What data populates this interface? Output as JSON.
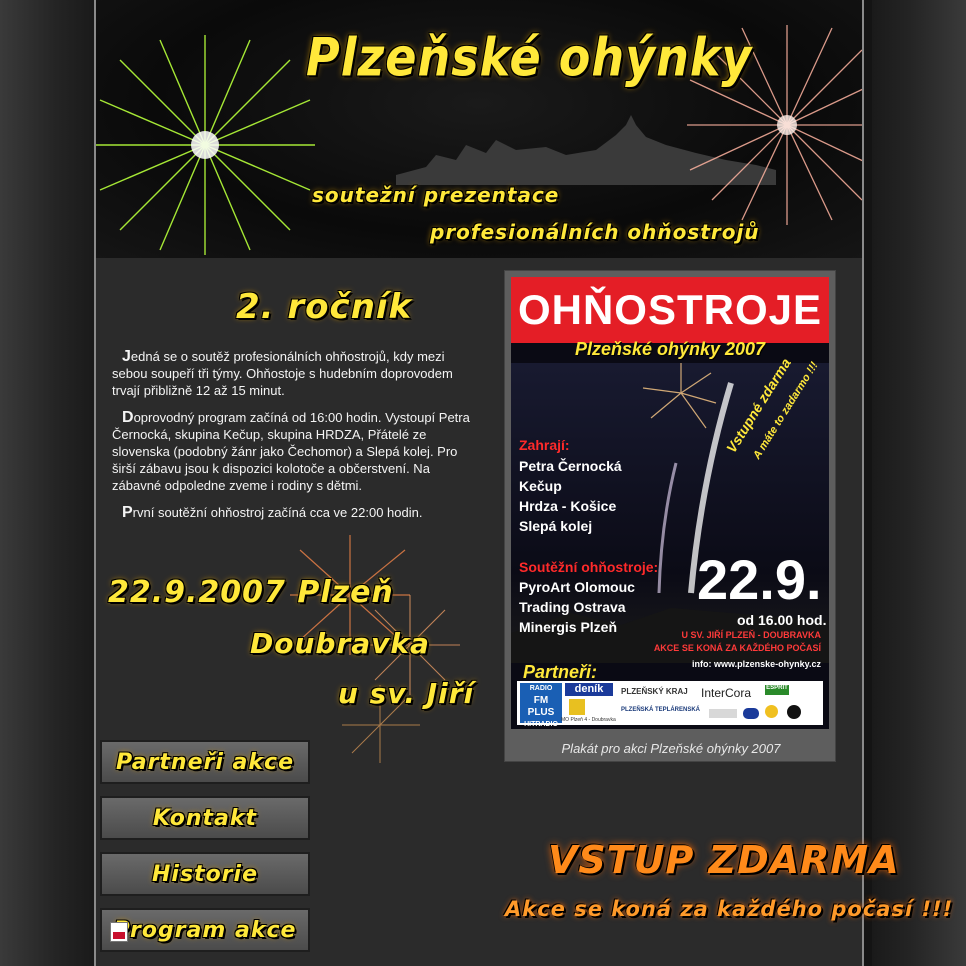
{
  "header": {
    "title": "Plzeňské ohýnky",
    "tagline1": "soutežní prezentace",
    "tagline2": "profesionálních ohňostrojů"
  },
  "main": {
    "edition": "2. ročník",
    "paragraphs": [
      {
        "cap": "J",
        "text": "edná se o soutěž profesionálních ohňostrojů, kdy mezi sebou soupeří tři týmy. Ohňostoje s hudebním doprovodem trvají přibližně 12 až 15 minut."
      },
      {
        "cap": "D",
        "text": "oprovodný program začíná od 16:00 hodin. Vystoupí Petra Černocká, skupina Kečup, skupina HRDZA, Přátelé ze slovenska (podobný žánr jako Čechomor) a Slepá kolej. Pro širší zábavu jsou k dispozici kolotoče a občerstvení. Na zábavné odpoledne zveme i rodiny s dětmi."
      },
      {
        "cap": "P",
        "text": "rvní soutěžní ohňostroj začíná cca ve 22:00 hodin."
      }
    ],
    "date_line1": "22.9.2007 Plzeň",
    "date_line2": "Doubravka",
    "date_line3": "u sv. Jiří"
  },
  "nav": [
    {
      "label": "Partneři akce",
      "icon": ""
    },
    {
      "label": "Kontakt",
      "icon": ""
    },
    {
      "label": "Historie",
      "icon": ""
    },
    {
      "label": "Program akce",
      "icon": "pdf-icon"
    }
  ],
  "poster": {
    "banner": "OHŇOSTROJE",
    "subtitle": "Plzeňské ohýnky 2007",
    "diag1": "Vstupné zdarma",
    "diag2": "A máte to zadarmo !!!",
    "zahraji_label": "Zahrají:",
    "performers": [
      "Petra Černocká",
      "Kečup",
      "Hrdza - Košice",
      "Slepá kolej"
    ],
    "souteze_label": "Soutěžní ohňostroje:",
    "competitors": [
      "PyroArt Olomouc",
      "Trading Ostrava",
      "Minergis Plzeň"
    ],
    "date": "22.9.",
    "time": "od 16.00 hod.",
    "location1": "U SV. JIŘÍ PLZEŇ - DOUBRAVKA",
    "location2": "AKCE SE KONÁ ZA KAŽDÉHO POČASÍ",
    "info": "info: www.plzenske-ohynky.cz",
    "partners_label": "Partneři:",
    "partner_logos": {
      "radio_line1": "RADIO",
      "radio_line2": "FM PLUS",
      "radio_line3": "HITRADIO",
      "denik": "deník",
      "kraj": "PLZEŇSKÝ KRAJ",
      "intercora": "InterCora",
      "esprit": "ESPRIT",
      "mo": "MO Plzeň 4 - Doubravka",
      "teplarenska": "PLZEŇSKÁ TEPLÁRENSKÁ"
    },
    "caption": "Plakát pro akci Plzeňské ohýnky 2007"
  },
  "promo": {
    "headline": "VSTUP ZDARMA",
    "subline": "Akce se koná za každého počasí !!!"
  },
  "colors": {
    "accent_yellow": "#ffe83a",
    "accent_orange": "#ff8a1a",
    "poster_red": "#e41e26"
  }
}
